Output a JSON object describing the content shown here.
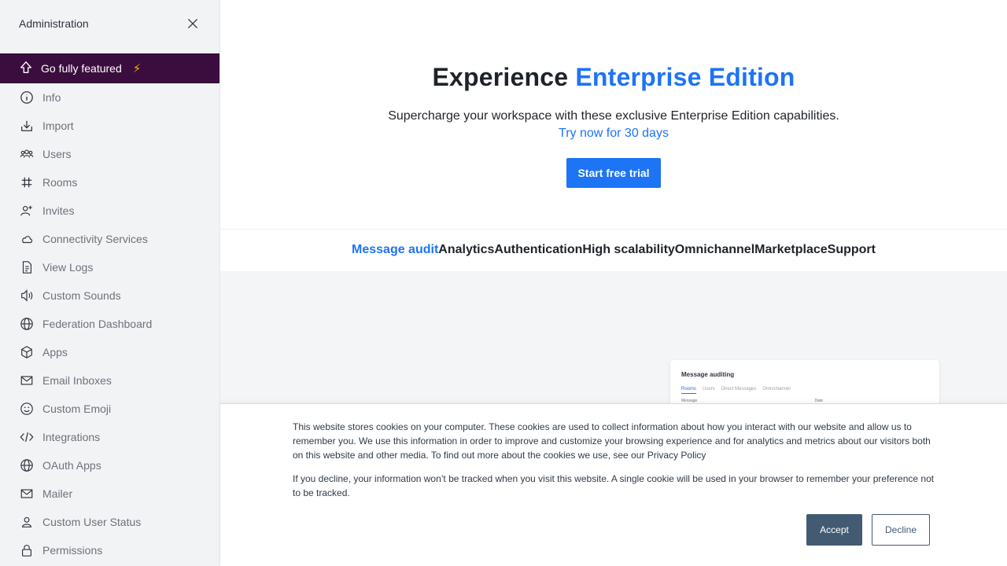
{
  "sidebar": {
    "title": "Administration",
    "featured_label": "Go fully featured",
    "items": [
      {
        "label": "Info",
        "icon": "info-icon"
      },
      {
        "label": "Import",
        "icon": "import-icon"
      },
      {
        "label": "Users",
        "icon": "team-icon"
      },
      {
        "label": "Rooms",
        "icon": "hashtag-icon"
      },
      {
        "label": "Invites",
        "icon": "user-plus-icon"
      },
      {
        "label": "Connectivity Services",
        "icon": "cloud-icon"
      },
      {
        "label": "View Logs",
        "icon": "document-icon"
      },
      {
        "label": "Custom Sounds",
        "icon": "speaker-icon"
      },
      {
        "label": "Federation Dashboard",
        "icon": "globe-icon"
      },
      {
        "label": "Apps",
        "icon": "cube-icon"
      },
      {
        "label": "Email Inboxes",
        "icon": "mail-icon"
      },
      {
        "label": "Custom Emoji",
        "icon": "emoji-icon"
      },
      {
        "label": "Integrations",
        "icon": "code-icon"
      },
      {
        "label": "OAuth Apps",
        "icon": "globe-icon"
      },
      {
        "label": "Mailer",
        "icon": "mail-icon"
      },
      {
        "label": "Custom User Status",
        "icon": "user-icon"
      },
      {
        "label": "Permissions",
        "icon": "lock-icon"
      }
    ]
  },
  "hero": {
    "title_prefix": "Experience",
    "title_accent": "Enterprise Edition",
    "subtitle": "Supercharge your workspace with these exclusive Enterprise Edition capabilities.",
    "trial_link": "Try now for 30 days",
    "cta": "Start free trial"
  },
  "tabs": [
    "Message audit",
    "Analytics",
    "Authentication",
    "High scalability",
    "Omnichannel",
    "Marketplace",
    "Support"
  ],
  "preview": {
    "card_title": "Message auditing",
    "card_tabs": [
      "Rooms",
      "Users",
      "Direct Messages",
      "Omnichannel"
    ],
    "card_cols": [
      "Message",
      "Date"
    ]
  },
  "cookie": {
    "p1": "This website stores cookies on your computer. These cookies are used to collect information about how you interact with our website and allow us to remember you. We use this information in order to improve and customize your browsing experience and for analytics and metrics about our visitors both on this website and other media. To find out more about the cookies we use, see our Privacy Policy",
    "p2": "If you decline, your information won’t be tracked when you visit this website. A single cookie will be used in your browser to remember your preference not to be tracked.",
    "accept": "Accept",
    "decline": "Decline"
  },
  "colors": {
    "accent": "#1d74f5",
    "featured_bg": "#3b0d3f",
    "cookie_button": "#435a73"
  }
}
